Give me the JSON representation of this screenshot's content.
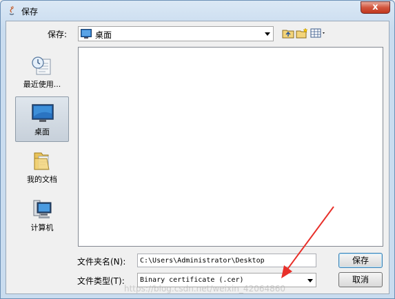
{
  "window": {
    "title": "保存",
    "close_glyph": "x"
  },
  "header": {
    "save_in_label": "保存:",
    "save_in_value": "桌面"
  },
  "places": [
    {
      "label": "最近使用...",
      "icon": "recent-places-icon"
    },
    {
      "label": "桌面",
      "icon": "desktop-icon",
      "selected": true
    },
    {
      "label": "我的文档",
      "icon": "documents-folder-icon"
    },
    {
      "label": "计算机",
      "icon": "computer-icon"
    }
  ],
  "footer": {
    "folder_name_label": "文件夹名(N):",
    "folder_name_value": "C:\\Users\\Administrator\\Desktop",
    "file_type_label": "文件类型(T):",
    "file_type_value": "Binary certificate (.cer)",
    "save_button": "保存",
    "cancel_button": "取消"
  },
  "watermark": "https://blog.csdn.net/weixin_42064860",
  "colors": {
    "accent": "#3c7fb1",
    "annotation_arrow": "#e8302a",
    "close_button": "#c0381f"
  }
}
